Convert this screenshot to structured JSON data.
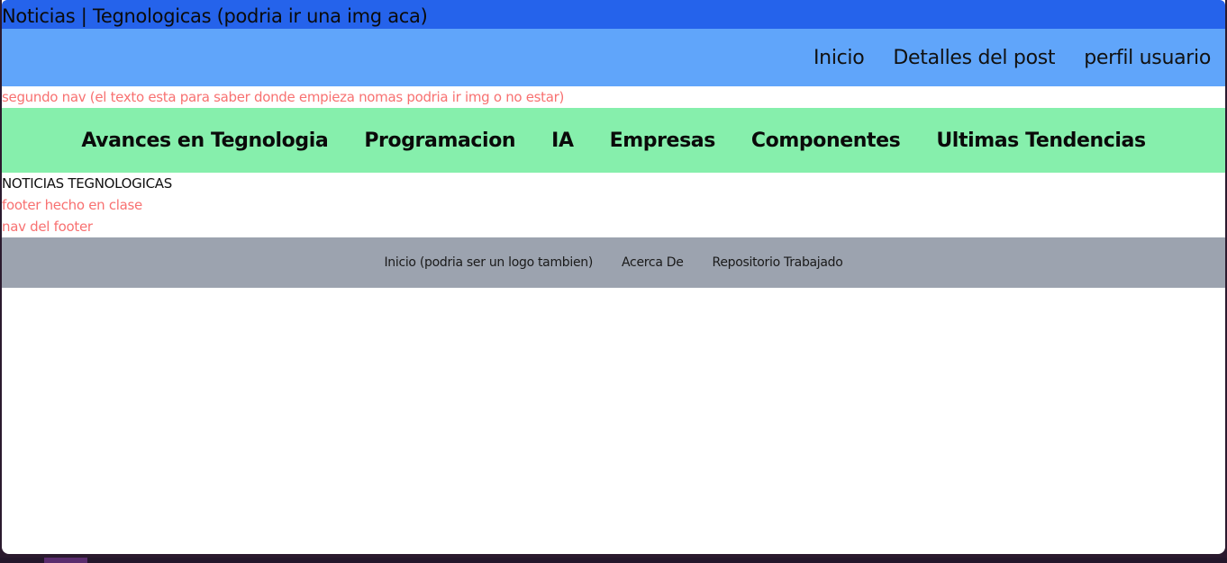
{
  "title_bar": {
    "text": "Noticias | Tegnologicas (podria ir una img aca)"
  },
  "main_nav": {
    "items": [
      {
        "label": "Inicio"
      },
      {
        "label": "Detalles del post"
      },
      {
        "label": "perfil usuario"
      }
    ]
  },
  "second_nav_note": "segundo nav (el texto esta para saber donde empieza nomas podria ir img o no estar)",
  "second_nav": {
    "items": [
      {
        "label": "Avances en Tegnologia"
      },
      {
        "label": "Programacion"
      },
      {
        "label": "IA"
      },
      {
        "label": "Empresas"
      },
      {
        "label": "Componentes"
      },
      {
        "label": "Ultimas Tendencias"
      }
    ]
  },
  "section_heading": "NOTICIAS TEGNOLOGICAS",
  "footer_note": "footer hecho en clase",
  "footer_nav_note": "nav del footer",
  "footer_nav": {
    "items": [
      {
        "label": "Inicio (podria ser un logo tambien)"
      },
      {
        "label": "Acerca De"
      },
      {
        "label": "Repositorio Trabajado"
      }
    ]
  },
  "colors": {
    "title_bar": "#2563eb",
    "main_nav": "#60a5fa",
    "second_nav": "#86efac",
    "footer_nav": "#9ca3af",
    "note_text": "#f87171"
  }
}
